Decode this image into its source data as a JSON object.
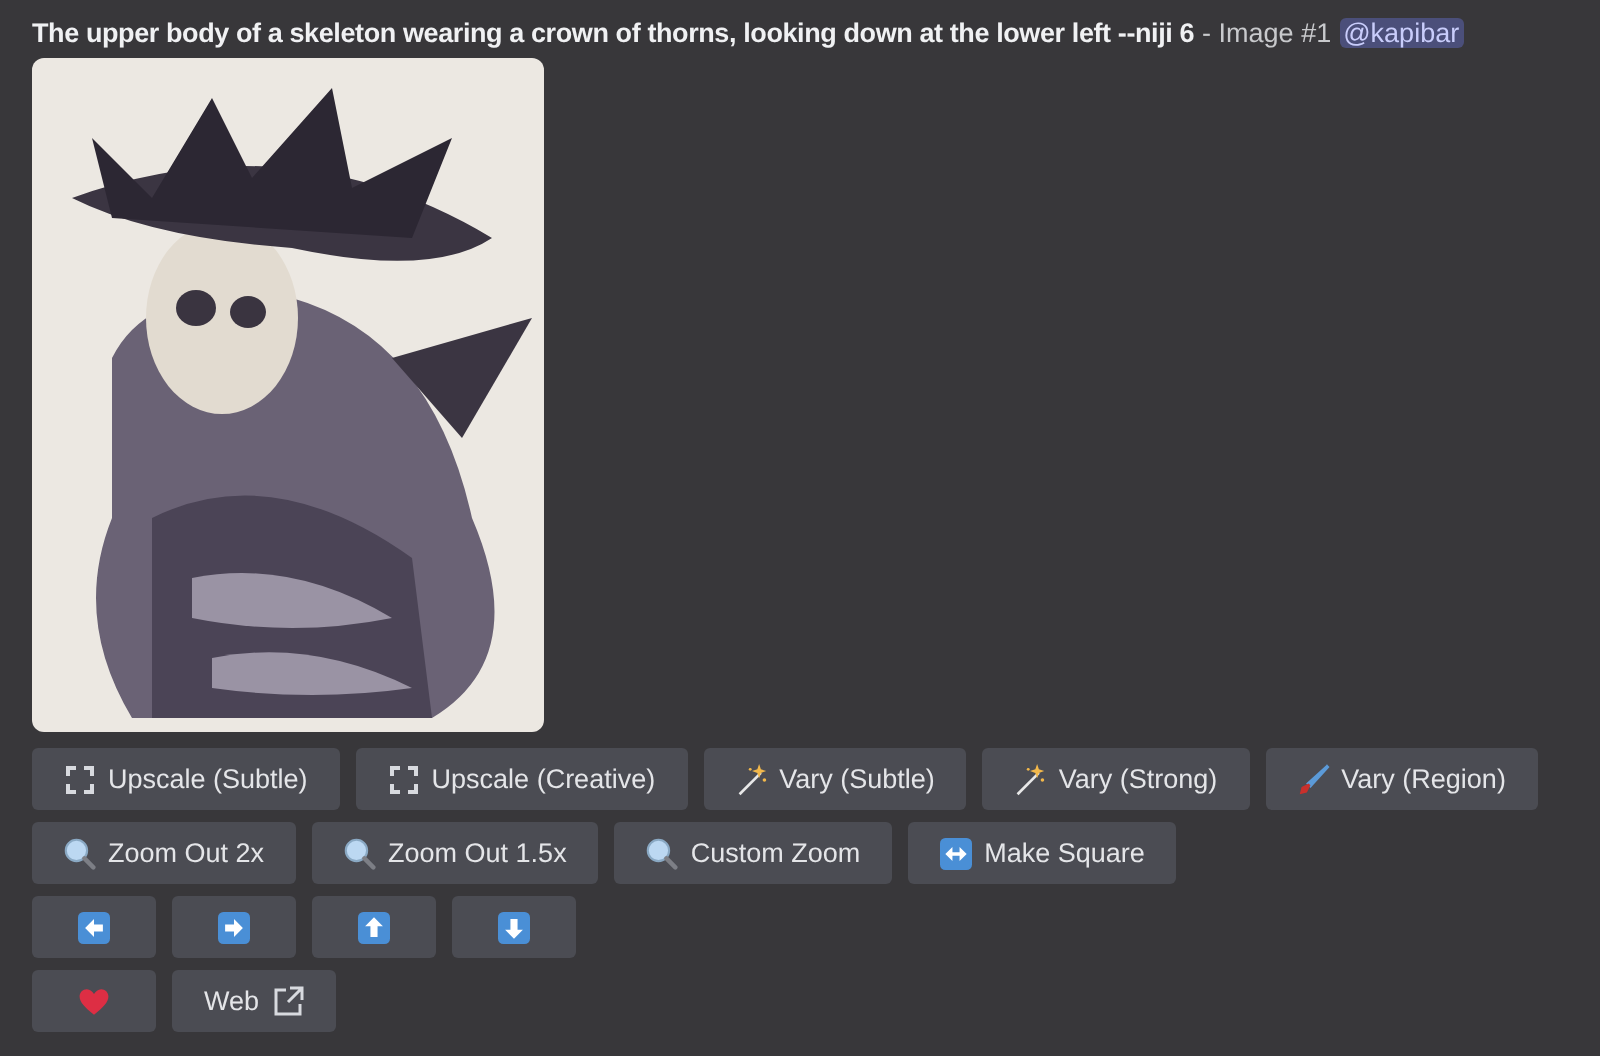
{
  "message": {
    "prompt": "The upper body of a skeleton wearing a crown of thorns, looking down at the lower left --niji 6",
    "suffix": "- Image #1",
    "mention": "@kapibar"
  },
  "image": {
    "kind": "picture"
  },
  "button_rows": [
    [
      {
        "kind": "expand",
        "label": "Upscale (Subtle)"
      },
      {
        "kind": "expand",
        "label": "Upscale (Creative)"
      },
      {
        "kind": "wand",
        "label": "Vary (Subtle)"
      },
      {
        "kind": "wand",
        "label": "Vary (Strong)"
      },
      {
        "kind": "brush",
        "label": "Vary (Region)"
      }
    ],
    [
      {
        "kind": "zoom",
        "label": "Zoom Out 2x"
      },
      {
        "kind": "zoom",
        "label": "Zoom Out 1.5x"
      },
      {
        "kind": "zoom",
        "label": "Custom Zoom"
      },
      {
        "kind": "square",
        "label": "Make Square"
      }
    ],
    [
      {
        "kind": "left"
      },
      {
        "kind": "right"
      },
      {
        "kind": "up"
      },
      {
        "kind": "down"
      }
    ],
    [
      {
        "kind": "heart"
      },
      {
        "kind": "link",
        "label": "Web"
      }
    ]
  ]
}
